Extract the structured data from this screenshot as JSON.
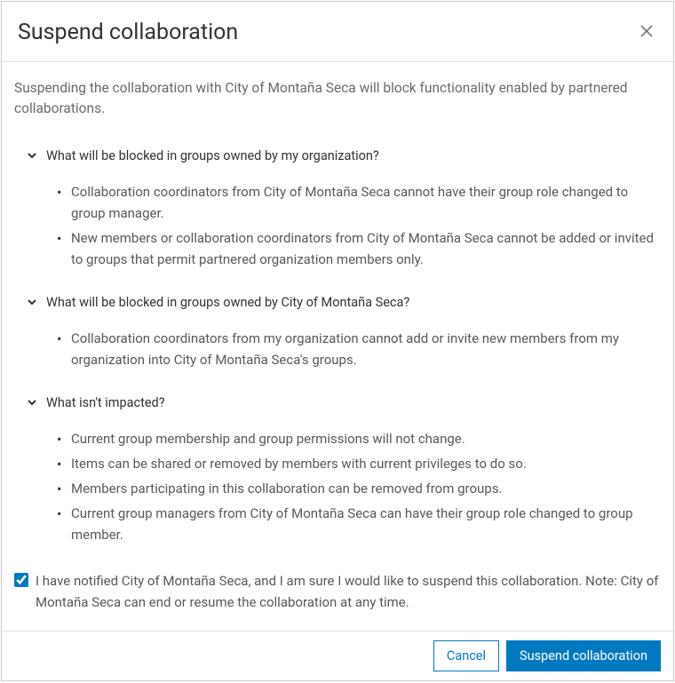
{
  "header": {
    "title": "Suspend collaboration"
  },
  "intro": "Suspending the collaboration with City of Montaña Seca will block functionality enabled by partnered collaborations.",
  "sections": [
    {
      "title": "What will be blocked in groups owned by my organization?",
      "items": [
        "Collaboration coordinators from City of Montaña Seca cannot have their group role changed to group manager.",
        "New members or collaboration coordinators from City of Montaña Seca cannot be added or invited to groups that permit partnered organization members only."
      ]
    },
    {
      "title": "What will be blocked in groups owned by City of Montaña Seca?",
      "items": [
        "Collaboration coordinators from my organization cannot add or invite new members from my organization into City of Montaña Seca's groups."
      ]
    },
    {
      "title": "What isn't impacted?",
      "items": [
        "Current group membership and group permissions will not change.",
        "Items can be shared or removed by members with current privileges to do so.",
        "Members participating in this collaboration can be removed from groups.",
        "Current group managers from City of Montaña Seca can have their group role changed to group member."
      ]
    }
  ],
  "confirm": {
    "text": "I have notified City of Montaña Seca, and I am sure I would like to suspend this collaboration. Note: City of Montaña Seca can end or resume the collaboration at any time.",
    "checked": true
  },
  "footer": {
    "cancel_label": "Cancel",
    "primary_label": "Suspend collaboration"
  }
}
